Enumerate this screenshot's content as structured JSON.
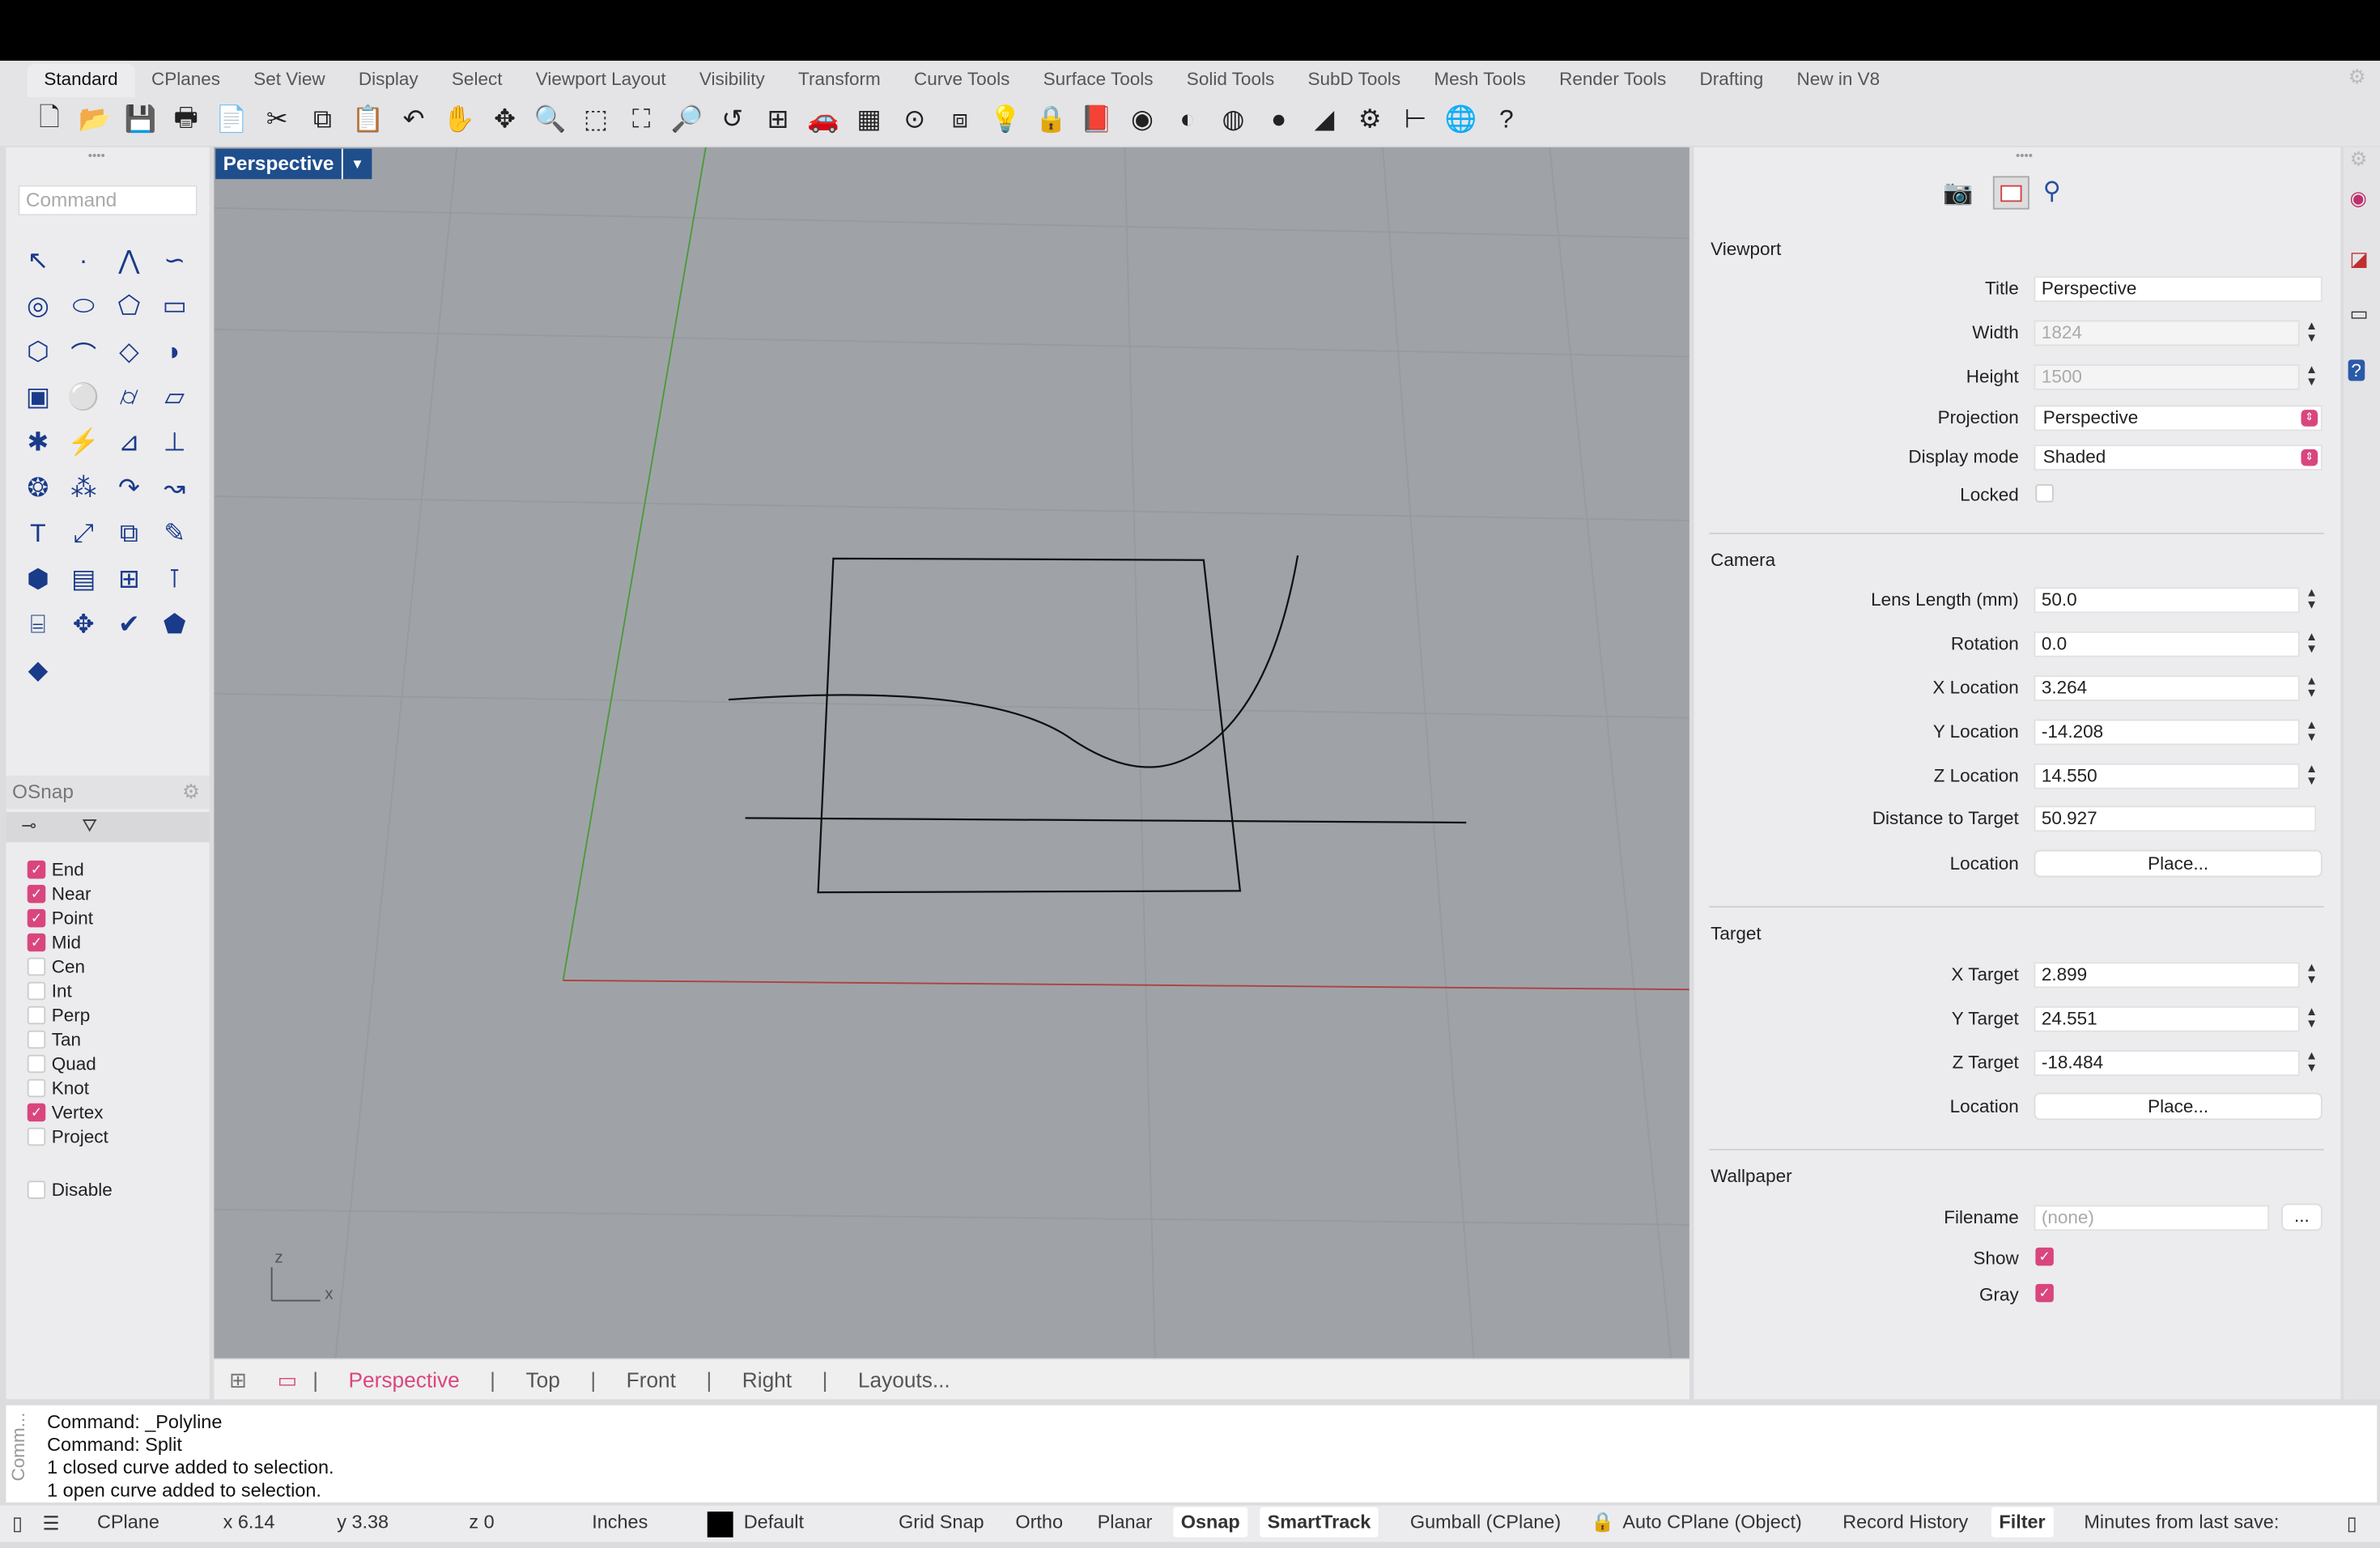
{
  "tabs": [
    "Standard",
    "CPlanes",
    "Set View",
    "Display",
    "Select",
    "Viewport Layout",
    "Visibility",
    "Transform",
    "Curve Tools",
    "Surface Tools",
    "Solid Tools",
    "SubD Tools",
    "Mesh Tools",
    "Render Tools",
    "Drafting",
    "New in V8"
  ],
  "toolbar_icons": [
    [
      "new-file-icon",
      "🗋"
    ],
    [
      "open-folder-icon",
      "📂"
    ],
    [
      "save-icon",
      "💾"
    ],
    [
      "print-icon",
      "🖶"
    ],
    [
      "export-icon",
      "📄"
    ],
    [
      "cut-icon",
      "✂"
    ],
    [
      "copy-icon",
      "⧉"
    ],
    [
      "paste-icon",
      "📋"
    ],
    [
      "undo-icon",
      "↶"
    ],
    [
      "pan-hand-icon",
      "✋"
    ],
    [
      "rotate-view-icon",
      "✥"
    ],
    [
      "zoom-icon",
      "🔍"
    ],
    [
      "zoom-window-icon",
      "⬚"
    ],
    [
      "zoom-extents-icon",
      "⛶"
    ],
    [
      "zoom-selected-icon",
      "🔎"
    ],
    [
      "undo-view-icon",
      "↺"
    ],
    [
      "four-viewports-icon",
      "⊞"
    ],
    [
      "car-icon",
      "🚗"
    ],
    [
      "grid-plane-icon",
      "▦"
    ],
    [
      "osnap-icon",
      "⊙"
    ],
    [
      "layers-icon",
      "⧈"
    ],
    [
      "light-icon",
      "💡"
    ],
    [
      "lock-icon",
      "🔒"
    ],
    [
      "layer-panel-icon",
      "📕"
    ],
    [
      "color-wheel-icon",
      "◉"
    ],
    [
      "shaded-sphere-icon",
      "◐"
    ],
    [
      "wire-sphere-icon",
      "◍"
    ],
    [
      "rendered-sphere-icon",
      "●"
    ],
    [
      "material-icon",
      "◢"
    ],
    [
      "options-gear-icon",
      "⚙"
    ],
    [
      "dimension-icon",
      "⊢"
    ],
    [
      "render-globe-icon",
      "🌐"
    ],
    [
      "help-icon",
      "?"
    ]
  ],
  "viewport": {
    "title": "Perspective",
    "axis_label_x": "x",
    "axis_label_z": "z"
  },
  "command": {
    "placeholder": "Command"
  },
  "left_tools": [
    [
      "select-arrow-icon",
      "↖"
    ],
    [
      "point-icon",
      "·"
    ],
    [
      "polyline-icon",
      "⋀"
    ],
    [
      "curve-icon",
      "∽"
    ],
    [
      "circle-icon",
      "◎"
    ],
    [
      "ellipse-icon",
      "⬭"
    ],
    [
      "polygon-icon",
      "⬠"
    ],
    [
      "rectangle-icon",
      "▭"
    ],
    [
      "fillet-icon",
      "⬡"
    ],
    [
      "arc-icon",
      "⌒"
    ],
    [
      "surface-icon",
      "◇"
    ],
    [
      "loft-icon",
      "◗"
    ],
    [
      "box-icon",
      "▣"
    ],
    [
      "spheres-icon",
      "⚪"
    ],
    [
      "cylinder-icon",
      "⌭"
    ],
    [
      "surface-patch-icon",
      "▱"
    ],
    [
      "explode-icon",
      "✱"
    ],
    [
      "boolean-icon",
      "⚡"
    ],
    [
      "extrude-icon",
      "⊿"
    ],
    [
      "split-icon",
      "⊥"
    ],
    [
      "group-icon",
      "❂"
    ],
    [
      "nodes-icon",
      "⁂"
    ],
    [
      "rebuild-icon",
      "↷"
    ],
    [
      "offset-icon",
      "↝"
    ],
    [
      "text-icon",
      "T"
    ],
    [
      "scale-icon",
      "⤢"
    ],
    [
      "array-icon",
      "⧉"
    ],
    [
      "edit-icon",
      "✎"
    ],
    [
      "block-icon",
      "⬢"
    ],
    [
      "hatch-icon",
      "▤"
    ],
    [
      "grid-array-icon",
      "⊞"
    ],
    [
      "dimension-icon",
      "⊺"
    ],
    [
      "analysis-icon",
      "⌸"
    ],
    [
      "gumball-icon",
      "✥"
    ],
    [
      "check-icon",
      "✔"
    ],
    [
      "mesh-icon",
      "⬟"
    ],
    [
      "cplane-icon",
      "◆"
    ]
  ],
  "osnap": {
    "title": "OSnap",
    "items": [
      {
        "label": "End",
        "on": true
      },
      {
        "label": "Near",
        "on": true
      },
      {
        "label": "Point",
        "on": true
      },
      {
        "label": "Mid",
        "on": true
      },
      {
        "label": "Cen",
        "on": false
      },
      {
        "label": "Int",
        "on": false
      },
      {
        "label": "Perp",
        "on": false
      },
      {
        "label": "Tan",
        "on": false
      },
      {
        "label": "Quad",
        "on": false
      },
      {
        "label": "Knot",
        "on": false
      },
      {
        "label": "Vertex",
        "on": true
      },
      {
        "label": "Project",
        "on": false
      }
    ],
    "disable": "Disable"
  },
  "viewport_tabs": [
    "Perspective",
    "Top",
    "Front",
    "Right",
    "Layouts..."
  ],
  "properties": {
    "viewport_section": "Viewport",
    "title_label": "Title",
    "title": "Perspective",
    "width_label": "Width",
    "width": "1824",
    "height_label": "Height",
    "height": "1500",
    "projection_label": "Projection",
    "projection": "Perspective",
    "display_mode_label": "Display mode",
    "display_mode": "Shaded",
    "locked_label": "Locked",
    "camera_section": "Camera",
    "lens_label": "Lens Length (mm)",
    "lens": "50.0",
    "rotation_label": "Rotation",
    "rotation": "0.0",
    "xloc_label": "X Location",
    "xloc": "3.264",
    "yloc_label": "Y Location",
    "yloc": "-14.208",
    "zloc_label": "Z Location",
    "zloc": "14.550",
    "dist_label": "Distance to Target",
    "dist": "50.927",
    "location_label": "Location",
    "place": "Place...",
    "target_section": "Target",
    "xt_label": "X Target",
    "xt": "2.899",
    "yt_label": "Y Target",
    "yt": "24.551",
    "zt_label": "Z Target",
    "zt": "-18.484",
    "wallpaper_section": "Wallpaper",
    "filename_label": "Filename",
    "filename_placeholder": "(none)",
    "browse": "...",
    "show_label": "Show",
    "gray_label": "Gray"
  },
  "command_history": {
    "side_label": "Comm...",
    "lines": [
      "Command: _Polyline",
      "Command: Split",
      "1 closed curve added to selection.",
      "1 open curve added to selection."
    ]
  },
  "status": {
    "cplane": "CPlane",
    "x": "x 6.14",
    "y": "y 3.38",
    "z": "z 0",
    "units": "Inches",
    "layer": "Default",
    "grid_snap": "Grid Snap",
    "ortho": "Ortho",
    "planar": "Planar",
    "osnap": "Osnap",
    "smarttrack": "SmartTrack",
    "gumball": "Gumball (CPlane)",
    "auto_cplane": "Auto CPlane (Object)",
    "record_history": "Record History",
    "filter": "Filter",
    "minutes": "Minutes from last save: "
  },
  "colors": {
    "accent": "#d9467f",
    "viewport_title_bg": "#1f4e8c",
    "viewport_bg": "#9fa3a8",
    "x_axis": "#b04040",
    "y_axis": "#4c9a3a"
  }
}
